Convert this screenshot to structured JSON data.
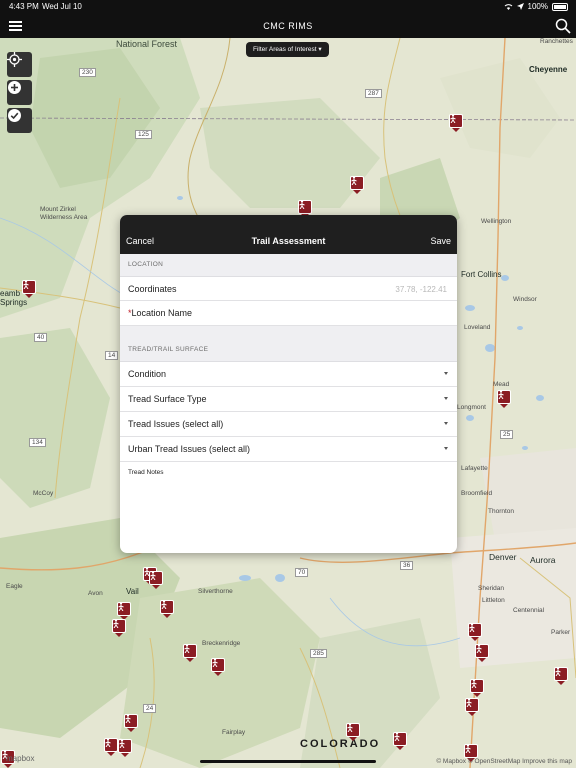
{
  "status_bar": {
    "time": "4:43 PM",
    "date": "Wed Jul 10",
    "battery": "100%"
  },
  "nav": {
    "title": "CMC RIMS",
    "menu_icon": "hamburger-icon",
    "search_icon": "search-icon"
  },
  "map": {
    "filter_button": "Filter Areas of Interest ▾",
    "controls": [
      {
        "icon": "location-target-icon"
      },
      {
        "icon": "plus-icon"
      },
      {
        "icon": "check-icon"
      }
    ],
    "labels": {
      "national_forest": "National Forest",
      "ranchettes": "Ranchettes",
      "cheyenne": "Cheyenne",
      "mount_zirkel": "Mount Zirkel",
      "wilderness_area": "Wilderness Area",
      "wellington": "Wellington",
      "steamboat_springs": "eamb",
      "springs": "Springs",
      "fort_collins": "Fort Collins",
      "windsor": "Windsor",
      "loveland": "Loveland",
      "mead": "Mead",
      "longmont": "Longmont",
      "lafayette": "Lafayette",
      "broomfield": "Broomfield",
      "thornton": "Thornton",
      "denver": "Denver",
      "aurora": "Aurora",
      "sheridan": "Sheridan",
      "littleton": "Littleton",
      "centennial": "Centennial",
      "parker": "Parker",
      "mccoy": "McCoy",
      "eagle": "Eagle",
      "avon": "Avon",
      "vail": "Vail",
      "silverthorne": "Silverthorne",
      "breckenridge": "Breckenridge",
      "fairplay": "Fairplay",
      "colorado": "COLORADO"
    },
    "highway_shields": [
      "230",
      "125",
      "287",
      "40",
      "14",
      "134",
      "70",
      "285",
      "24",
      "36",
      "25"
    ],
    "attribution": "© Mapbox © OpenStreetMap Improve this map",
    "logo": "mapbox"
  },
  "modal": {
    "cancel_label": "Cancel",
    "title": "Trail Assessment",
    "save_label": "Save",
    "location_section": "LOCATION",
    "coordinates_label": "Coordinates",
    "coordinates_value": "37.78, -122.41",
    "location_name_required": "*",
    "location_name_label": "Location Name",
    "tread_section": "TREAD/TRAIL SURFACE",
    "condition_label": "Condition",
    "surface_type_label": "Tread Surface Type",
    "tread_issues_label": "Tread Issues (select all)",
    "urban_issues_label": "Urban Tread Issues (select all)",
    "notes_label": "Tread Notes"
  }
}
